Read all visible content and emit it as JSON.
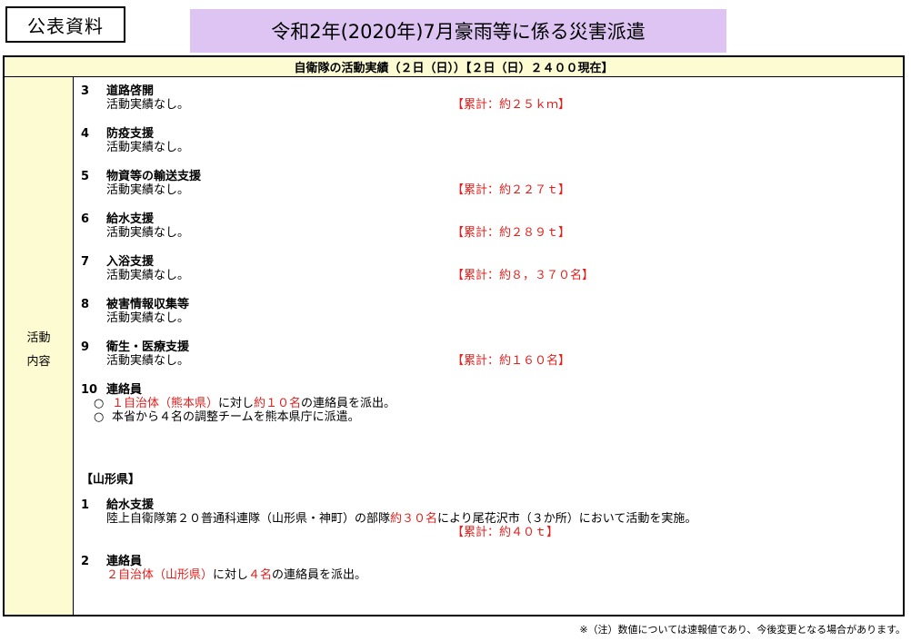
{
  "badge": "公表資料",
  "title": "令和2年(2020年)7月豪雨等に係る災害派遣",
  "table_header": "自衛隊の活動実績（２日（日））【２日（日）２４００現在】",
  "side_label": {
    "line1": "活動",
    "line2": "内容"
  },
  "items": [
    {
      "num": "3",
      "title": "道路啓開",
      "body": "活動実績なし。",
      "total": "【累計：約２５ｋｍ】"
    },
    {
      "num": "4",
      "title": "防疫支援",
      "body": "活動実績なし。",
      "total": ""
    },
    {
      "num": "5",
      "title": "物資等の輸送支援",
      "body": "活動実績なし。",
      "total": "【累計：約２２７ｔ】"
    },
    {
      "num": "6",
      "title": "給水支援",
      "body": "活動実績なし。",
      "total": "【累計：約２８９ｔ】"
    },
    {
      "num": "7",
      "title": "入浴支援",
      "body": "活動実績なし。",
      "total": "【累計：約８，３７０名】"
    },
    {
      "num": "8",
      "title": "被害情報収集等",
      "body": "活動実績なし。",
      "total": ""
    },
    {
      "num": "9",
      "title": "衛生・医療支援",
      "body": "活動実績なし。",
      "total": "【累計：約１６０名】"
    }
  ],
  "item10": {
    "num": "10",
    "title": "連絡員",
    "bullet_mark": "○",
    "b1_red1": "１自治体（熊本県）",
    "b1_mid": "に対し",
    "b1_red2": "約１０名",
    "b1_end": "の連絡員を派出。",
    "b2": "本省から４名の調整チームを熊本県庁に派遣。"
  },
  "section": "【山形県】",
  "y1": {
    "num": "1",
    "title": "給水支援",
    "pre": "陸上自衛隊第２０普通科連隊（山形県・神町）の部隊",
    "red": "約３０名",
    "post": "により尾花沢市（３か所）において活動を実施。",
    "total": "【累計：約４０ｔ】"
  },
  "y2": {
    "num": "2",
    "title": "連絡員",
    "red1": "２自治体（山形県）",
    "mid": "に対し",
    "red2": "４名",
    "end": "の連絡員を派出。"
  },
  "footnote": "※（注）数値については速報値であり、今後変更となる場合があります。",
  "colors": {
    "title_bg": "#ddc4f2",
    "label_bg": "#fdfbd2",
    "accent_red": "#e1201d"
  }
}
